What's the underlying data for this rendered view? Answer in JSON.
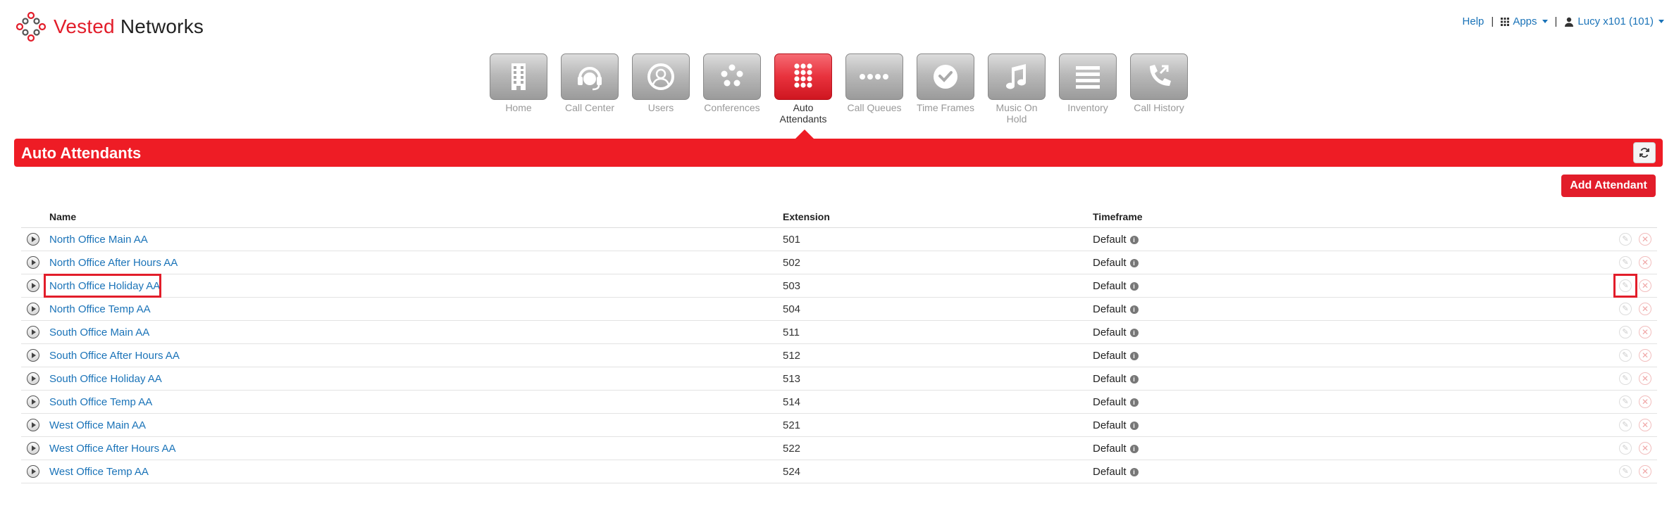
{
  "brand": {
    "word1": "Vested",
    "word2": "Networks",
    "accent_color": "#ee1c25"
  },
  "topnav": {
    "help": "Help",
    "apps": "Apps",
    "user": "Lucy x101 (101)",
    "sep": "|"
  },
  "apps": [
    {
      "label": "Home",
      "icon": "building-icon"
    },
    {
      "label": "Call Center",
      "icon": "headset-icon"
    },
    {
      "label": "Users",
      "icon": "users-icon"
    },
    {
      "label": "Conferences",
      "icon": "conference-icon"
    },
    {
      "label": "Auto Attendants",
      "icon": "keypad-icon",
      "active": true
    },
    {
      "label": "Call Queues",
      "icon": "queue-dots-icon"
    },
    {
      "label": "Time Frames",
      "icon": "clock-icon"
    },
    {
      "label": "Music On Hold",
      "icon": "music-note-icon"
    },
    {
      "label": "Inventory",
      "icon": "list-lines-icon"
    },
    {
      "label": "Call History",
      "icon": "phone-history-icon"
    }
  ],
  "page": {
    "title": "Auto Attendants",
    "add_button": "Add Attendant"
  },
  "table": {
    "columns": [
      "Name",
      "Extension",
      "Timeframe"
    ],
    "rows": [
      {
        "name": "North Office Main AA",
        "ext": "501",
        "timeframe": "Default"
      },
      {
        "name": "North Office After Hours AA",
        "ext": "502",
        "timeframe": "Default"
      },
      {
        "name": "North Office Holiday AA",
        "ext": "503",
        "timeframe": "Default"
      },
      {
        "name": "North Office Temp AA",
        "ext": "504",
        "timeframe": "Default"
      },
      {
        "name": "South Office Main AA",
        "ext": "511",
        "timeframe": "Default"
      },
      {
        "name": "South Office After Hours AA",
        "ext": "512",
        "timeframe": "Default"
      },
      {
        "name": "South Office Holiday AA",
        "ext": "513",
        "timeframe": "Default"
      },
      {
        "name": "South Office Temp AA",
        "ext": "514",
        "timeframe": "Default"
      },
      {
        "name": "West Office Main AA",
        "ext": "521",
        "timeframe": "Default"
      },
      {
        "name": "West Office After Hours AA",
        "ext": "522",
        "timeframe": "Default"
      },
      {
        "name": "West Office Temp AA",
        "ext": "524",
        "timeframe": "Default"
      }
    ]
  }
}
